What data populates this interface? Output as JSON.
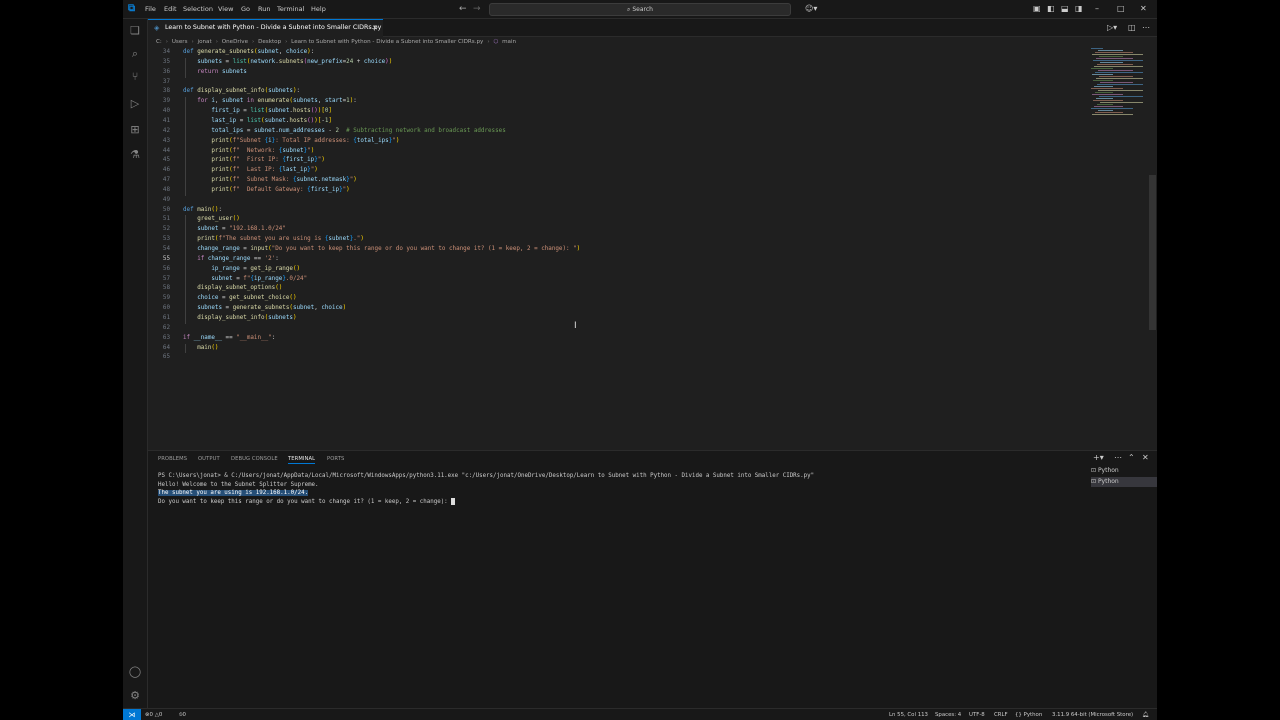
{
  "titlebar": {
    "menus": [
      "File",
      "Edit",
      "Selection",
      "View",
      "Go",
      "Run",
      "Terminal",
      "Help"
    ],
    "search_placeholder": "Search"
  },
  "editor": {
    "tab_label": "Learn to Subnet with Python - Divide a Subnet into Smaller CIDRs.py",
    "breadcrumb": [
      "C:",
      "Users",
      "jonat",
      "OneDrive",
      "Desktop",
      "Learn to Subnet with Python - Divide a Subnet into Smaller CIDRs.py",
      "main"
    ],
    "active_line": 55,
    "lines": [
      {
        "n": 34,
        "html": "<span class=\"kw\">def</span> <span class=\"fn\">generate_subnets</span><span class=\"brc\">(</span><span class=\"var\">subnet</span>, <span class=\"var\">choice</span><span class=\"brc\">)</span>:"
      },
      {
        "n": 35,
        "html": "    <span class=\"var\">subnets</span> = <span class=\"cls\">list</span><span class=\"brc\">(</span><span class=\"var\">network</span>.<span class=\"fn\">subnets</span><span class=\"par\">(</span><span class=\"var\">new_prefix</span>=<span class=\"num\">24</span> + <span class=\"var\">choice</span><span class=\"par\">)</span><span class=\"brc\">)</span>"
      },
      {
        "n": 36,
        "html": "    <span class=\"kw2\">return</span> <span class=\"var\">subnets</span>"
      },
      {
        "n": 37,
        "html": ""
      },
      {
        "n": 38,
        "html": "<span class=\"kw\">def</span> <span class=\"fn\">display_subnet_info</span><span class=\"brc\">(</span><span class=\"var\">subnets</span><span class=\"brc\">)</span>:"
      },
      {
        "n": 39,
        "html": "    <span class=\"kw2\">for</span> <span class=\"var\">i</span>, <span class=\"var\">subnet</span> <span class=\"kw2\">in</span> <span class=\"fn\">enumerate</span><span class=\"brc\">(</span><span class=\"var\">subnets</span>, <span class=\"var\">start</span>=<span class=\"num\">1</span><span class=\"brc\">)</span>:"
      },
      {
        "n": 40,
        "html": "        <span class=\"var\">first_ip</span> = <span class=\"cls\">list</span><span class=\"brc\">(</span><span class=\"var\">subnet</span>.<span class=\"fn\">hosts</span><span class=\"par\">()</span><span class=\"brc\">)</span><span class=\"brc\">[</span><span class=\"num\">0</span><span class=\"brc\">]</span>"
      },
      {
        "n": 41,
        "html": "        <span class=\"var\">last_ip</span> = <span class=\"cls\">list</span><span class=\"brc\">(</span><span class=\"var\">subnet</span>.<span class=\"fn\">hosts</span><span class=\"par\">()</span><span class=\"brc\">)</span><span class=\"brc\">[</span>-<span class=\"num\">1</span><span class=\"brc\">]</span>"
      },
      {
        "n": 42,
        "html": "        <span class=\"var\">total_ips</span> = <span class=\"var\">subnet</span>.<span class=\"var\">num_addresses</span> - <span class=\"num\">2</span>  <span class=\"cmt\"># Subtracting network and broadcast addresses</span>"
      },
      {
        "n": 43,
        "html": "        <span class=\"fn\">print</span><span class=\"brc\">(</span><span class=\"str\">f\"Subnet </span><span class=\"sq\">{</span><span class=\"var\">i</span><span class=\"sq\">}</span><span class=\"str\">: Total IP addresses: </span><span class=\"sq\">{</span><span class=\"var\">total_ips</span><span class=\"sq\">}</span><span class=\"str\">\"</span><span class=\"brc\">)</span>"
      },
      {
        "n": 44,
        "html": "        <span class=\"fn\">print</span><span class=\"brc\">(</span><span class=\"str\">f\"  Network: </span><span class=\"sq\">{</span><span class=\"var\">subnet</span><span class=\"sq\">}</span><span class=\"str\">\"</span><span class=\"brc\">)</span>"
      },
      {
        "n": 45,
        "html": "        <span class=\"fn\">print</span><span class=\"brc\">(</span><span class=\"str\">f\"  First IP: </span><span class=\"sq\">{</span><span class=\"var\">first_ip</span><span class=\"sq\">}</span><span class=\"str\">\"</span><span class=\"brc\">)</span>"
      },
      {
        "n": 46,
        "html": "        <span class=\"fn\">print</span><span class=\"brc\">(</span><span class=\"str\">f\"  Last IP: </span><span class=\"sq\">{</span><span class=\"var\">last_ip</span><span class=\"sq\">}</span><span class=\"str\">\"</span><span class=\"brc\">)</span>"
      },
      {
        "n": 47,
        "html": "        <span class=\"fn\">print</span><span class=\"brc\">(</span><span class=\"str\">f\"  Subnet Mask: </span><span class=\"sq\">{</span><span class=\"var\">subnet</span>.<span class=\"var\">netmask</span><span class=\"sq\">}</span><span class=\"str\">\"</span><span class=\"brc\">)</span>"
      },
      {
        "n": 48,
        "html": "        <span class=\"fn\">print</span><span class=\"brc\">(</span><span class=\"str\">f\"  Default Gateway: </span><span class=\"sq\">{</span><span class=\"var\">first_ip</span><span class=\"sq\">}</span><span class=\"str\">\"</span><span class=\"brc\">)</span>"
      },
      {
        "n": 49,
        "html": ""
      },
      {
        "n": 50,
        "html": "<span class=\"kw\">def</span> <span class=\"fn\">main</span><span class=\"brc\">()</span>:"
      },
      {
        "n": 51,
        "html": "    <span class=\"fn\">greet_user</span><span class=\"brc\">()</span>"
      },
      {
        "n": 52,
        "html": "    <span class=\"var\">subnet</span> = <span class=\"str\">\"192.168.1.0/24\"</span>"
      },
      {
        "n": 53,
        "html": "    <span class=\"fn\">print</span><span class=\"brc\">(</span><span class=\"str\">f\"The subnet you are using is </span><span class=\"sq\">{</span><span class=\"var\">subnet</span><span class=\"sq\">}</span><span class=\"str\">.\"</span><span class=\"brc\">)</span>"
      },
      {
        "n": 54,
        "html": "    <span class=\"var\">change_range</span> = <span class=\"fn\">input</span><span class=\"brc\">(</span><span class=\"str\">\"Do you want to keep this range or do you want to change it? (1 = keep, 2 = change): \"</span><span class=\"brc\">)</span>"
      },
      {
        "n": 55,
        "html": "    <span class=\"kw2\">if</span> <span class=\"var\">change_range</span> == <span class=\"str\">'2'</span>:"
      },
      {
        "n": 56,
        "html": "        <span class=\"var\">ip_range</span> = <span class=\"fn\">get_ip_range</span><span class=\"brc\">()</span>"
      },
      {
        "n": 57,
        "html": "        <span class=\"var\">subnet</span> = <span class=\"str\">f\"</span><span class=\"sq\">{</span><span class=\"var\">ip_range</span><span class=\"sq\">}</span><span class=\"str\">.0/24\"</span>"
      },
      {
        "n": 58,
        "html": "    <span class=\"fn\">display_subnet_options</span><span class=\"brc\">()</span>"
      },
      {
        "n": 59,
        "html": "    <span class=\"var\">choice</span> = <span class=\"fn\">get_subnet_choice</span><span class=\"brc\">()</span>"
      },
      {
        "n": 60,
        "html": "    <span class=\"var\">subnets</span> = <span class=\"fn\">generate_subnets</span><span class=\"brc\">(</span><span class=\"var\">subnet</span>, <span class=\"var\">choice</span><span class=\"brc\">)</span>"
      },
      {
        "n": 61,
        "html": "    <span class=\"fn\">display_subnet_info</span><span class=\"brc\">(</span><span class=\"var\">subnets</span><span class=\"brc\">)</span>"
      },
      {
        "n": 62,
        "html": ""
      },
      {
        "n": 63,
        "html": "<span class=\"kw2\">if</span> <span class=\"var\">__name__</span> == <span class=\"str\">\"__main__\"</span>:"
      },
      {
        "n": 64,
        "html": "    <span class=\"fn\">main</span><span class=\"brc\">()</span>"
      },
      {
        "n": 65,
        "html": ""
      }
    ]
  },
  "panel": {
    "tabs": [
      "PROBLEMS",
      "OUTPUT",
      "DEBUG CONSOLE",
      "TERMINAL",
      "PORTS"
    ],
    "active_tab": "TERMINAL",
    "terminal_lines": [
      "PS C:\\Users\\jonat> & C:/Users/jonat/AppData/Local/Microsoft/WindowsApps/python3.11.exe \"c:/Users/jonat/OneDrive/Desktop/Learn to Subnet with Python - Divide a Subnet into Smaller CIDRs.py\"",
      "Hello! Welcome to the Subnet Splitter Supreme.",
      "The subnet you are using is 192.168.1.0/24.",
      "Do you want to keep this range or do you want to change it? (1 = keep, 2 = change): "
    ],
    "terminal_list": [
      "Python",
      "Python"
    ]
  },
  "statusbar": {
    "errors": "0",
    "warnings": "0",
    "ports": "0",
    "position": "Ln 55, Col 113",
    "spaces": "Spaces: 4",
    "encoding": "UTF-8",
    "eol": "CRLF",
    "language": "Python",
    "interpreter": "3.11.9 64-bit (Microsoft Store)"
  },
  "colors": {
    "accent": "#0078d4",
    "editor_bg": "#1f1f1f",
    "chrome_bg": "#181818",
    "selection": "#264f78"
  }
}
